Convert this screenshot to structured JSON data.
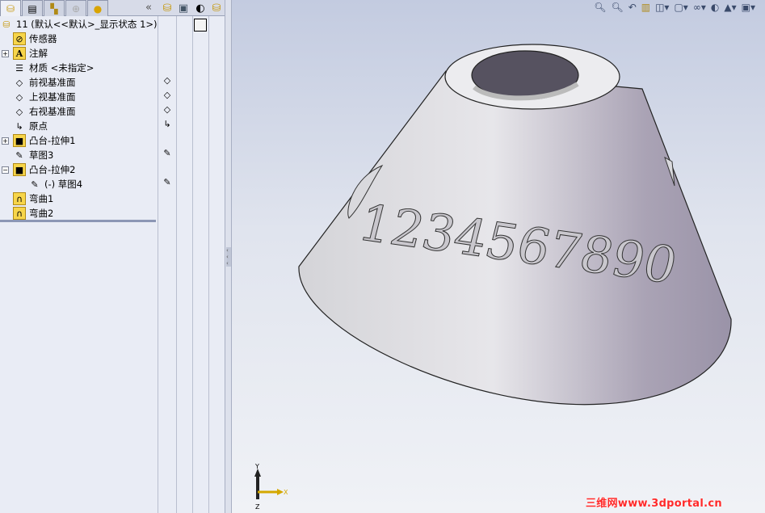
{
  "tabs": [
    {
      "name": "featuremanager",
      "icon": "feature-tree-icon",
      "active": true
    },
    {
      "name": "propertymanager",
      "icon": "property-icon"
    },
    {
      "name": "configurationmanager",
      "icon": "config-icon"
    },
    {
      "name": "dimxpert",
      "icon": "target-icon"
    },
    {
      "name": "display-manager",
      "icon": "appearance-icon"
    }
  ],
  "collapse_label": "«",
  "tree": {
    "root": "11    (默认<<默认>_显示状态 1>)",
    "items": [
      {
        "label": "传感器",
        "icon": "sensor-folder-icon"
      },
      {
        "label": "注解",
        "icon": "annotation-folder-icon",
        "expand": "+"
      },
      {
        "label": "材质 <未指定>",
        "icon": "material-icon"
      },
      {
        "label": "前视基准面",
        "icon": "plane-icon"
      },
      {
        "label": "上视基准面",
        "icon": "plane-icon"
      },
      {
        "label": "右视基准面",
        "icon": "plane-icon"
      },
      {
        "label": "原点",
        "icon": "origin-icon"
      },
      {
        "label": "凸台-拉伸1",
        "icon": "extrude-icon",
        "expand": "+"
      },
      {
        "label": "草图3",
        "icon": "sketch-icon"
      },
      {
        "label": "凸台-拉伸2",
        "icon": "extrude-icon",
        "expand": "−"
      },
      {
        "label": "(-) 草图4",
        "icon": "sketch-icon",
        "child": true
      },
      {
        "label": "弯曲1",
        "icon": "flex-icon"
      },
      {
        "label": "弯曲2",
        "icon": "flex-icon"
      }
    ]
  },
  "view_toolbar": [
    "zoom-to-fit-icon",
    "zoom-area-icon",
    "previous-view-icon",
    "section-view-icon",
    "view-orientation-icon",
    "display-style-icon",
    "hide-show-icon",
    "edit-appearance-icon",
    "apply-scene-icon",
    "view-settings-icon"
  ],
  "model_text": "1234567890",
  "triad": {
    "x": "X",
    "y": "Y",
    "z": "Z"
  },
  "watermark": "三维网www.3dportal.cn"
}
